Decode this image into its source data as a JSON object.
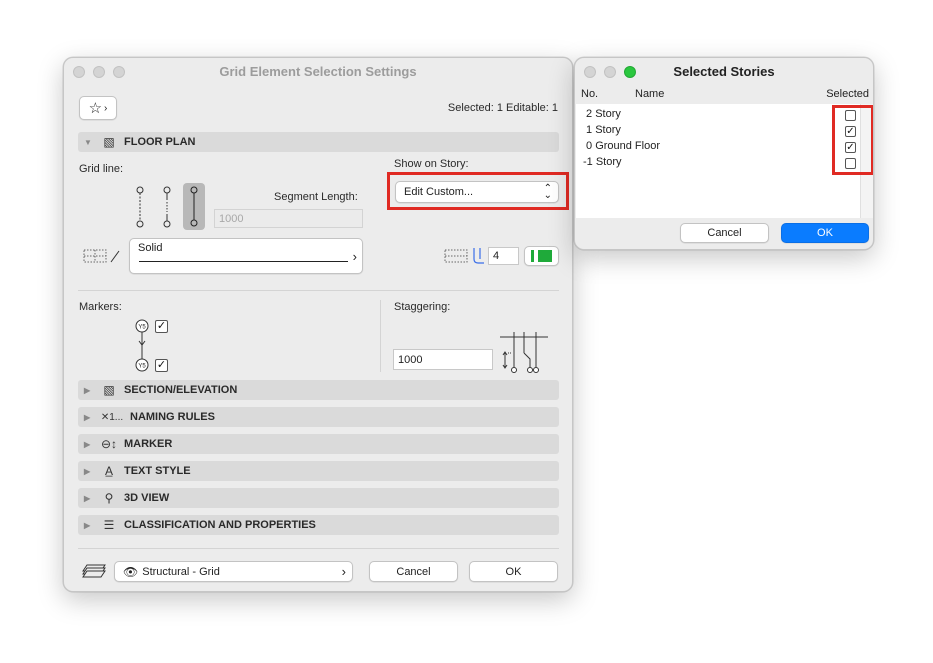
{
  "main": {
    "title": "Grid Element Selection Settings",
    "selected_info": "Selected: 1 Editable: 1",
    "favorites_icon": "star-icon",
    "floor_plan": {
      "header": "FLOOR PLAN",
      "grid_line_label": "Grid line:",
      "show_on_story_label": "Show on Story:",
      "show_on_story_value": "Edit Custom...",
      "segment_length_label": "Segment Length:",
      "segment_length_value": "1000",
      "line_type": "Solid",
      "pen_number": "4",
      "markers_label": "Markers:",
      "staggering_label": "Staggering:",
      "staggering_value": "1000",
      "marker_top_checked": true,
      "marker_bottom_checked": true
    },
    "sections": [
      {
        "label": "SECTION/ELEVATION",
        "icon": "section-elevation-icon"
      },
      {
        "label": "NAMING RULES",
        "icon": "naming-rules-icon"
      },
      {
        "label": "MARKER",
        "icon": "marker-icon"
      },
      {
        "label": "TEXT STYLE",
        "icon": "text-style-icon"
      },
      {
        "label": "3D VIEW",
        "icon": "3d-view-icon"
      },
      {
        "label": "CLASSIFICATION AND PROPERTIES",
        "icon": "classification-icon"
      }
    ],
    "layer_value": "Structural - Grid",
    "cancel_label": "Cancel",
    "ok_label": "OK"
  },
  "stories": {
    "title": "Selected Stories",
    "col_no": "No.",
    "col_name": "Name",
    "col_selected": "Selected",
    "rows": [
      {
        "no": "2",
        "name": "Story",
        "selected": false
      },
      {
        "no": "1",
        "name": "Story",
        "selected": true
      },
      {
        "no": "0",
        "name": "Ground Floor",
        "selected": true
      },
      {
        "no": "-1",
        "name": "Story",
        "selected": false
      }
    ],
    "cancel_label": "Cancel",
    "ok_label": "OK"
  },
  "colors": {
    "accent": "#0a7cff",
    "highlight": "#e02a23",
    "pen_color": "#1faa3a"
  }
}
